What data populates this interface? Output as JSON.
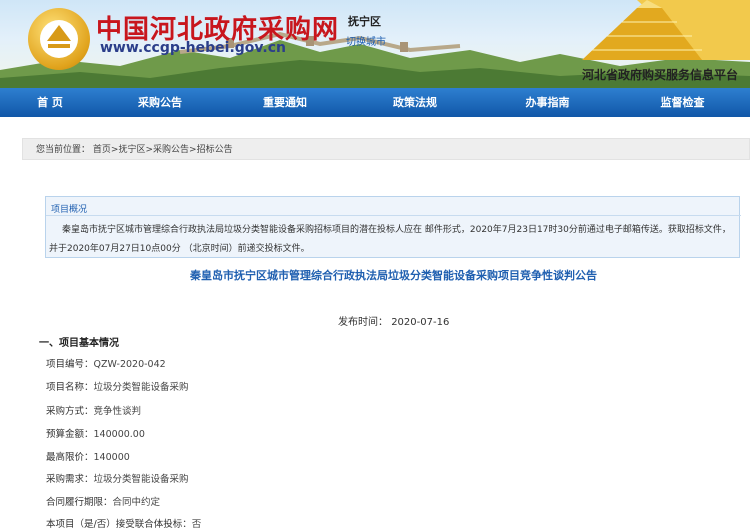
{
  "header": {
    "site_title": "中国河北政府采购网",
    "site_url": "www.ccgp-hebei.gov.cn",
    "region": "抚宁区",
    "switch_city": "切换城市",
    "sub_title": "河北省政府购买服务信息平台"
  },
  "nav": [
    {
      "label": "首 页"
    },
    {
      "label": "采购公告"
    },
    {
      "label": "重要通知"
    },
    {
      "label": "政策法规"
    },
    {
      "label": "办事指南"
    },
    {
      "label": "监督检查"
    }
  ],
  "breadcrumb": {
    "prefix": "您当前位置：",
    "items": [
      "首页",
      "抚宁区",
      "采购公告",
      "招标公告"
    ],
    "separator": ">"
  },
  "overview": {
    "title": "项目概况",
    "text": "秦皇岛市抚宁区城市管理综合行政执法局垃圾分类智能设备采购招标项目的潜在投标人应在 邮件形式，2020年7月23日17时30分前通过电子邮箱传送。获取招标文件，并于2020年07月27日10点00分 （北京时间）前递交投标文件。"
  },
  "notice": {
    "title": "秦皇岛市抚宁区城市管理综合行政执法局垃圾分类智能设备采购项目竞争性谈判公告",
    "publish_label": "发布时间：",
    "publish_date": "2020-07-16",
    "section_title": "一、项目基本情况"
  },
  "fields": [
    {
      "label": "项目编号：",
      "value": "QZW-2020-042"
    },
    {
      "label": "项目名称：",
      "value": "垃圾分类智能设备采购"
    },
    {
      "label": "采购方式：",
      "value": "竞争性谈判"
    },
    {
      "label": "预算金额：",
      "value": "140000.00"
    },
    {
      "label": "最高限价：",
      "value": "140000"
    },
    {
      "label": "采购需求：",
      "value": "垃圾分类智能设备采购"
    },
    {
      "label": "合同履行期限：",
      "value": "合同中约定"
    },
    {
      "label": "本项目（是/否）接受联合体投标：",
      "value": "否"
    }
  ],
  "colors": {
    "nav_bg": "#1a66b8",
    "title_red": "#c8161d",
    "link_blue": "#1f5fb0"
  }
}
